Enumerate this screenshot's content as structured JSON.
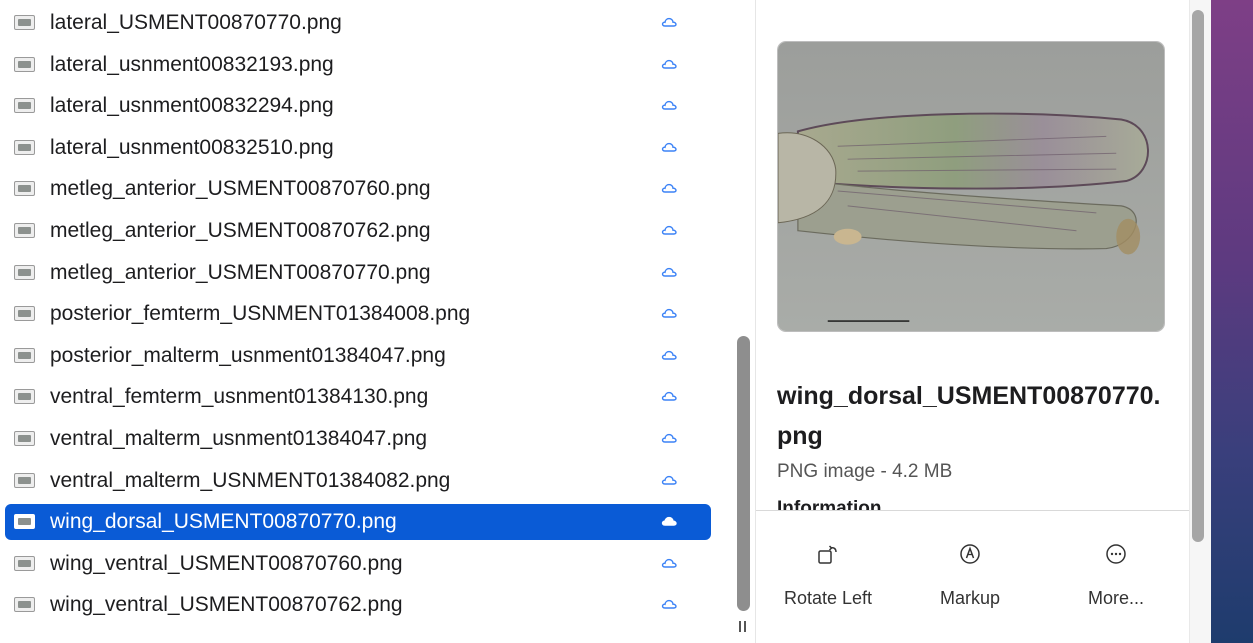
{
  "file_list": {
    "items": [
      {
        "name": "lateral_USMENT00870770.png",
        "icon": "image-file-icon",
        "status_icon": "cloud-icon"
      },
      {
        "name": "lateral_usnment00832193.png",
        "icon": "image-file-icon",
        "status_icon": "cloud-icon"
      },
      {
        "name": "lateral_usnment00832294.png",
        "icon": "image-file-icon",
        "status_icon": "cloud-icon"
      },
      {
        "name": "lateral_usnment00832510.png",
        "icon": "image-file-icon",
        "status_icon": "cloud-icon"
      },
      {
        "name": "metleg_anterior_USMENT00870760.png",
        "icon": "image-file-icon",
        "status_icon": "cloud-icon"
      },
      {
        "name": "metleg_anterior_USMENT00870762.png",
        "icon": "image-file-icon",
        "status_icon": "cloud-icon"
      },
      {
        "name": "metleg_anterior_USMENT00870770.png",
        "icon": "image-file-icon",
        "status_icon": "cloud-icon"
      },
      {
        "name": "posterior_femterm_USNMENT01384008.png",
        "icon": "image-file-icon",
        "status_icon": "cloud-icon"
      },
      {
        "name": "posterior_malterm_usnment01384047.png",
        "icon": "image-file-icon",
        "status_icon": "cloud-icon"
      },
      {
        "name": "ventral_femterm_usnment01384130.png",
        "icon": "image-file-icon",
        "status_icon": "cloud-icon"
      },
      {
        "name": "ventral_malterm_usnment01384047.png",
        "icon": "image-file-icon",
        "status_icon": "cloud-icon"
      },
      {
        "name": "ventral_malterm_USNMENT01384082.png",
        "icon": "image-file-icon",
        "status_icon": "cloud-icon"
      },
      {
        "name": "wing_dorsal_USMENT00870770.png",
        "icon": "image-file-icon",
        "status_icon": "cloud-icon",
        "selected": true
      },
      {
        "name": "wing_ventral_USMENT00870760.png",
        "icon": "image-file-icon",
        "status_icon": "cloud-icon"
      },
      {
        "name": "wing_ventral_USMENT00870762.png",
        "icon": "image-file-icon",
        "status_icon": "cloud-icon"
      }
    ],
    "selected_color": "#0a5bd6",
    "cloud_color": "#3b82f6"
  },
  "preview": {
    "file_name": "wing_dorsal_USMENT00870770.png",
    "kind_size": "PNG image - 4.2 MB",
    "info_heading": "Information",
    "actions": [
      {
        "label": "Rotate Left",
        "icon": "rotate-left-icon"
      },
      {
        "label": "Markup",
        "icon": "markup-icon"
      },
      {
        "label": "More...",
        "icon": "more-icon"
      }
    ]
  }
}
